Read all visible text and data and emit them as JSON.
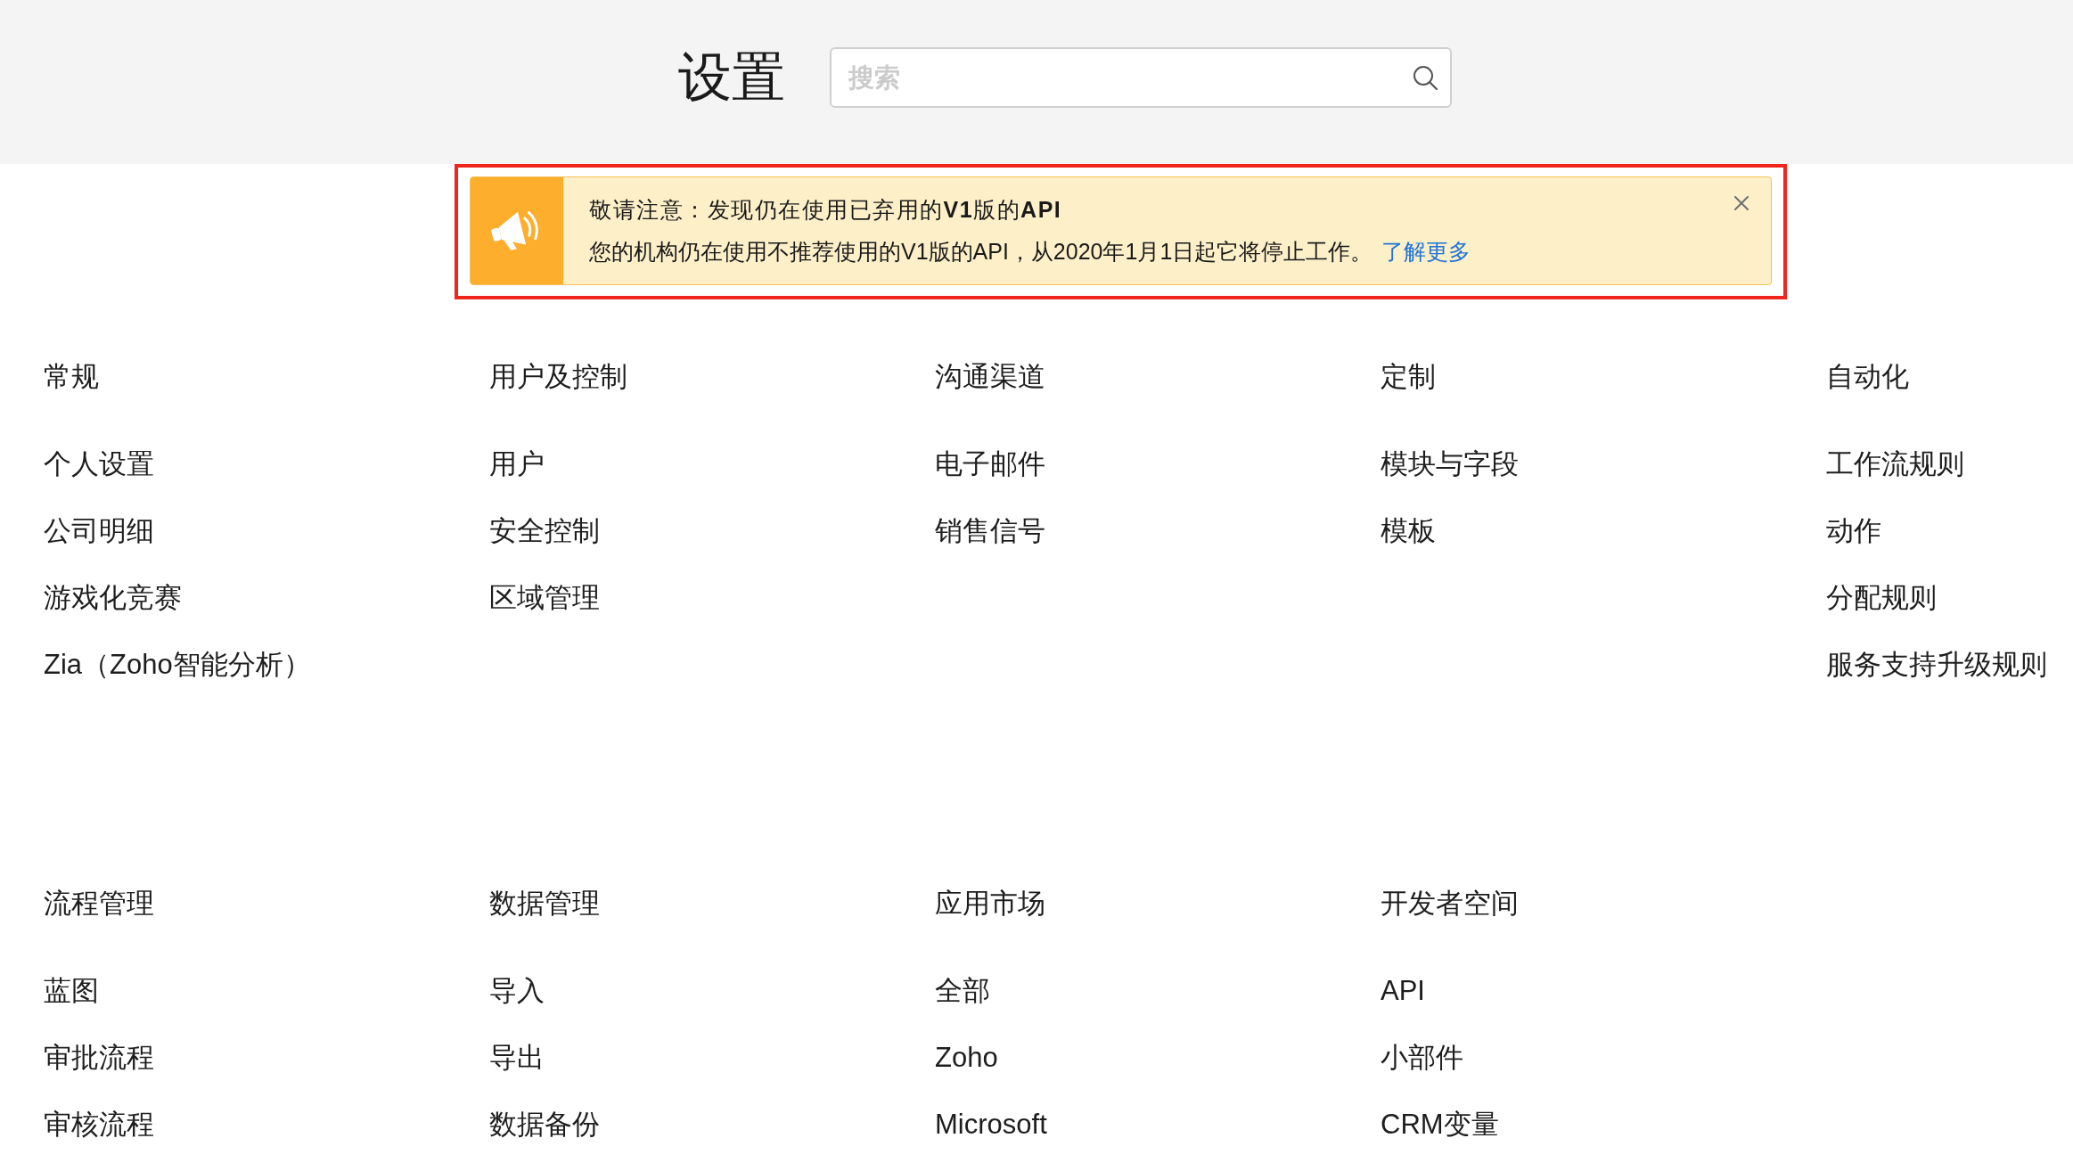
{
  "header": {
    "title": "设置",
    "search": {
      "placeholder": "搜索"
    }
  },
  "notice": {
    "title": "敬请注意：发现仍在使用已弃用的**V1**版的**API**",
    "message": "您的机构仍在使用不推荐使用的V1版的API，从2020年1月1日起它将停止工作。",
    "link": "了解更多"
  },
  "section_rows": [
    {
      "sections": [
        {
          "title": "常规",
          "items": [
            "个人设置",
            "公司明细",
            "游戏化竞赛",
            "Zia（Zoho智能分析）"
          ]
        },
        {
          "title": "用户及控制",
          "items": [
            "用户",
            "安全控制",
            "区域管理"
          ]
        },
        {
          "title": "沟通渠道",
          "items": [
            "电子邮件",
            "销售信号"
          ]
        },
        {
          "title": "定制",
          "items": [
            "模块与字段",
            "模板"
          ]
        },
        {
          "title": "自动化",
          "items": [
            "工作流规则",
            "动作",
            "分配规则",
            "服务支持升级规则"
          ]
        }
      ]
    },
    {
      "sections": [
        {
          "title": "流程管理",
          "items": [
            "蓝图",
            "审批流程",
            "审核流程"
          ]
        },
        {
          "title": "数据管理",
          "items": [
            "导入",
            "导出",
            "数据备份"
          ]
        },
        {
          "title": "应用市场",
          "items": [
            "全部",
            "Zoho",
            "Microsoft"
          ]
        },
        {
          "title": "开发者空间",
          "items": [
            "API",
            "小部件",
            "CRM变量"
          ]
        }
      ]
    }
  ]
}
